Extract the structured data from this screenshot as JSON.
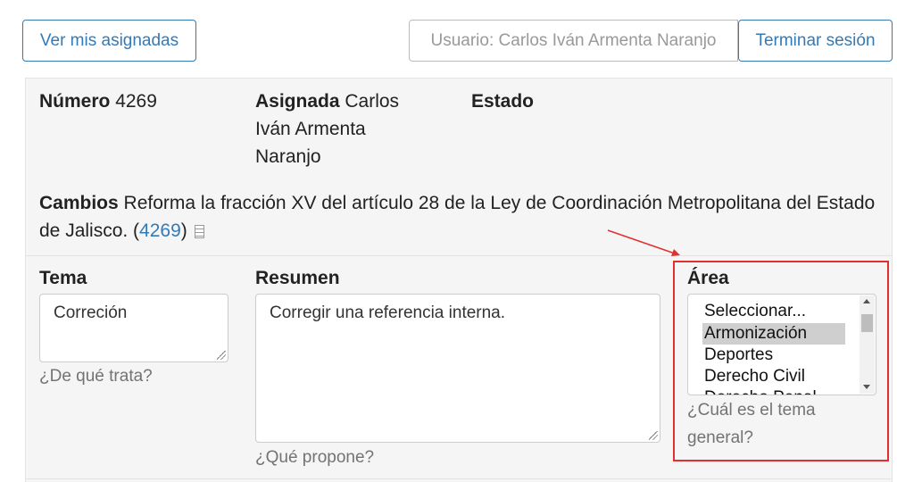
{
  "header": {
    "assigned_button": "Ver mis asignadas",
    "user_label": "Usuario: Carlos Iván Armenta Naranjo",
    "logout_button": "Terminar sesión"
  },
  "record": {
    "numero_label": "Número",
    "numero_value": "4269",
    "asignada_label": "Asignada",
    "asignada_value": "Carlos Iván Armenta Naranjo",
    "estado_label": "Estado",
    "estado_value": "",
    "cambios_label": "Cambios",
    "cambios_text": "Reforma la fracción XV del artículo 28 de la Ley de Coordinación Metropolitana del Estado de Jalisco.",
    "cambios_link": "4269",
    "cambios_icon": "document-icon"
  },
  "form": {
    "tema": {
      "label": "Tema",
      "value": "Correción",
      "help": "¿De qué trata?"
    },
    "resumen": {
      "label": "Resumen",
      "value": "Corregir una referencia interna.",
      "help": "¿Qué propone?"
    },
    "area": {
      "label": "Área",
      "help": "¿Cuál es el tema general?",
      "options": [
        "Seleccionar...",
        "Armonización",
        "Deportes",
        "Derecho Civil",
        "Derecho Penal"
      ],
      "selected": "Armonización"
    }
  },
  "annotation": {
    "color": "#e03030"
  },
  "colors": {
    "accent": "#337ab7",
    "panel": "#f5f5f5"
  }
}
